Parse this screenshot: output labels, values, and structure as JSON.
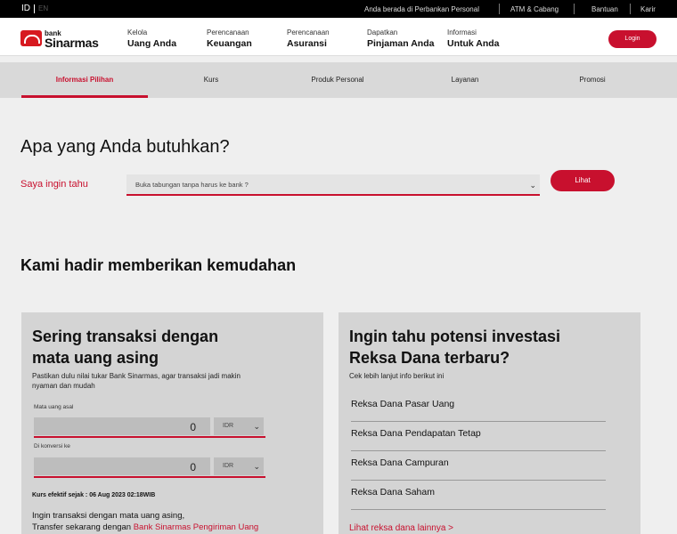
{
  "topbar": {
    "lang_active": "ID",
    "lang_inactive": "EN",
    "links": [
      "Anda berada di Perbankan Personal",
      "ATM & Cabang",
      "Bantuan",
      "Karir"
    ]
  },
  "logo": {
    "line1": "bank",
    "line2": "Sinarmas"
  },
  "nav": {
    "items": [
      {
        "sub": "Kelola",
        "main": "Uang Anda"
      },
      {
        "sub": "Perencanaan",
        "main": "Keuangan"
      },
      {
        "sub": "Perencanaan",
        "main": "Asuransi"
      },
      {
        "sub": "Dapatkan",
        "main": "Pinjaman Anda"
      },
      {
        "sub": "Informasi",
        "main": "Untuk Anda"
      }
    ],
    "login": "Login"
  },
  "subnav": {
    "tabs": [
      "Informasi Pilihan",
      "Kurs",
      "Produk Personal",
      "Layanan",
      "Promosi"
    ],
    "active_index": 0
  },
  "need": {
    "heading": "Apa yang Anda butuhkan?",
    "label": "Saya ingin tahu",
    "selected": "Buka tabungan tanpa harus ke bank ?",
    "button": "Lihat"
  },
  "ease": {
    "heading": "Kami hadir memberikan kemudahan"
  },
  "forex": {
    "title_line1": "Sering transaksi dengan",
    "title_line2": "mata uang asing",
    "desc_line1": "Pastikan dulu nilai tukar Bank Sinarmas, agar transaksi jadi makin",
    "desc_line2": "nyaman dan mudah",
    "from_label": "Mata uang asal",
    "from_value": "0",
    "from_currency": "IDR",
    "to_label": "Di konversi ke",
    "to_value": "0",
    "to_currency": "IDR",
    "rate_note": "Kurs efektif sejak : 06 Aug 2023 02:18WIB",
    "note_line1": "Ingin transaksi dengan mata uang asing,",
    "note_line2_prefix": "Transfer sekarang dengan ",
    "note_link": "Bank Sinarmas Pengiriman Uang"
  },
  "funds": {
    "title_line1": "Ingin tahu potensi investasi",
    "title_line2": "Reksa Dana terbaru?",
    "desc": "Cek lebih lanjut info berikut ini",
    "items": [
      "Reksa Dana Pasar Uang",
      "Reksa Dana Pendapatan Tetap",
      "Reksa Dana Campuran",
      "Reksa Dana Saham"
    ],
    "more": "Lihat reksa dana lainnya >"
  },
  "colors": {
    "accent": "#c8102e",
    "topbar": "#000000",
    "card": "#d4d4d4"
  }
}
